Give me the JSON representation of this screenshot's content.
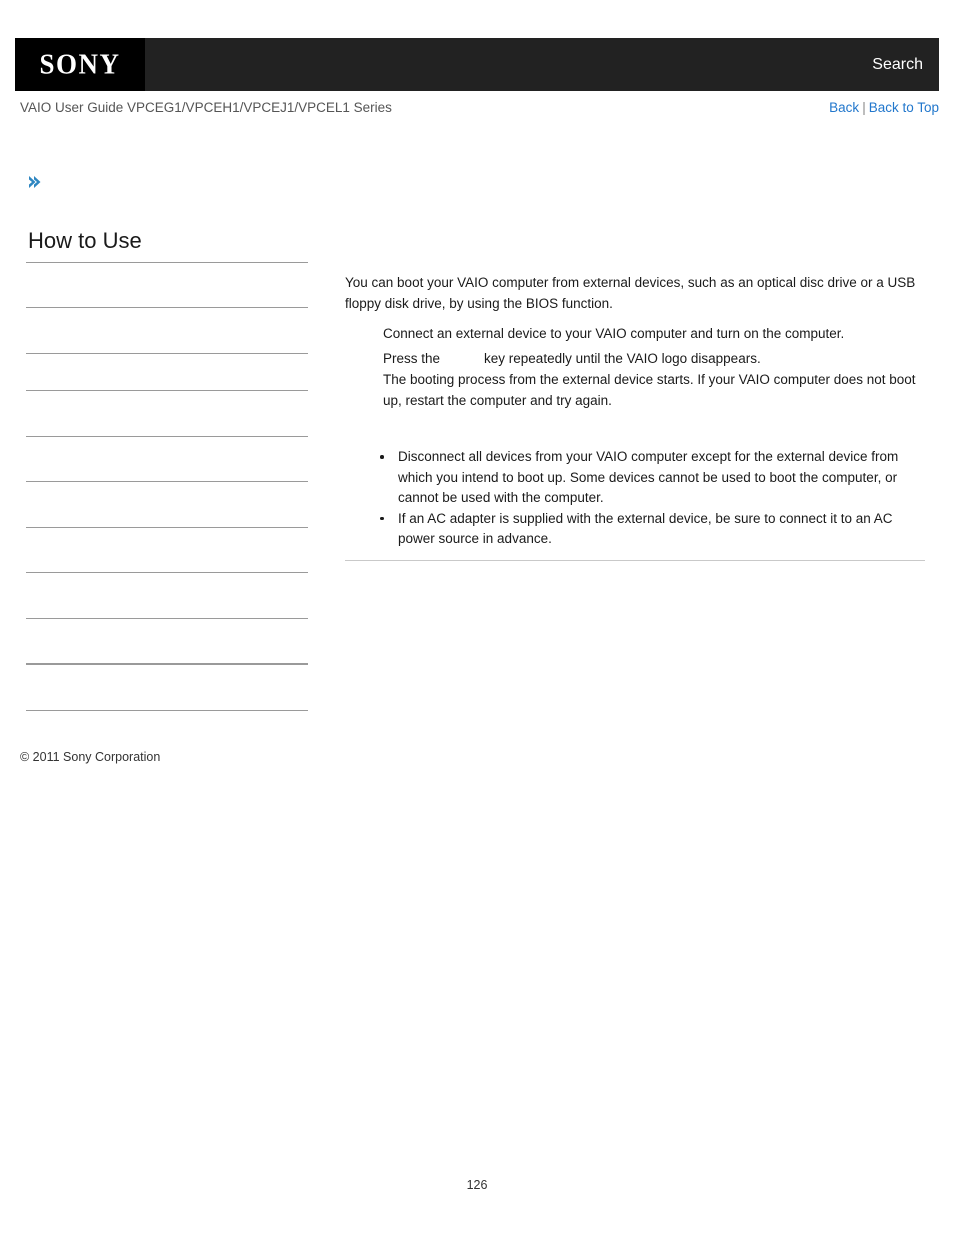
{
  "header": {
    "logo_text": "SONY",
    "search_label": "Search",
    "logo_bg": "#000000",
    "bar_bg": "#222222"
  },
  "sub_header": {
    "guide_title": "VAIO User Guide VPCEG1/VPCEH1/VPCEJ1/VPCEL1 Series",
    "back_label": "Back",
    "separator": "|",
    "back_to_top_label": "Back to Top",
    "link_color": "#2277cc"
  },
  "marker": {
    "icon": "chevron-right-icon",
    "color": "#2e86c1"
  },
  "sidebar": {
    "title": "How to Use",
    "copyright": "© 2011 Sony Corporation",
    "items": [
      {
        "label": ""
      },
      {
        "label": ""
      },
      {
        "label": ""
      },
      {
        "label": ""
      },
      {
        "label": ""
      },
      {
        "label": ""
      },
      {
        "label": ""
      },
      {
        "label": ""
      },
      {
        "label": ""
      },
      {
        "label": ""
      }
    ]
  },
  "content": {
    "intro": "You can boot your VAIO computer from external devices, such as an optical disc drive or a USB floppy disk drive, by using the BIOS function.",
    "steps": [
      {
        "text_before": "Connect an external device to your VAIO computer and turn on the computer.",
        "text_after": "",
        "note": ""
      },
      {
        "text_before": "Press the",
        "text_after": "key repeatedly until the VAIO logo disappears.",
        "note": "The booting process from the external device starts. If your VAIO computer does not boot up, restart the computer and try again."
      }
    ],
    "notes": [
      "Disconnect all devices from your VAIO computer except for the external device from which you intend to boot up. Some devices cannot be used to boot the computer, or cannot be used with the computer.",
      "If an AC adapter is supplied with the external device, be sure to connect it to an AC power source in advance."
    ]
  },
  "footer": {
    "page_number": "126"
  }
}
